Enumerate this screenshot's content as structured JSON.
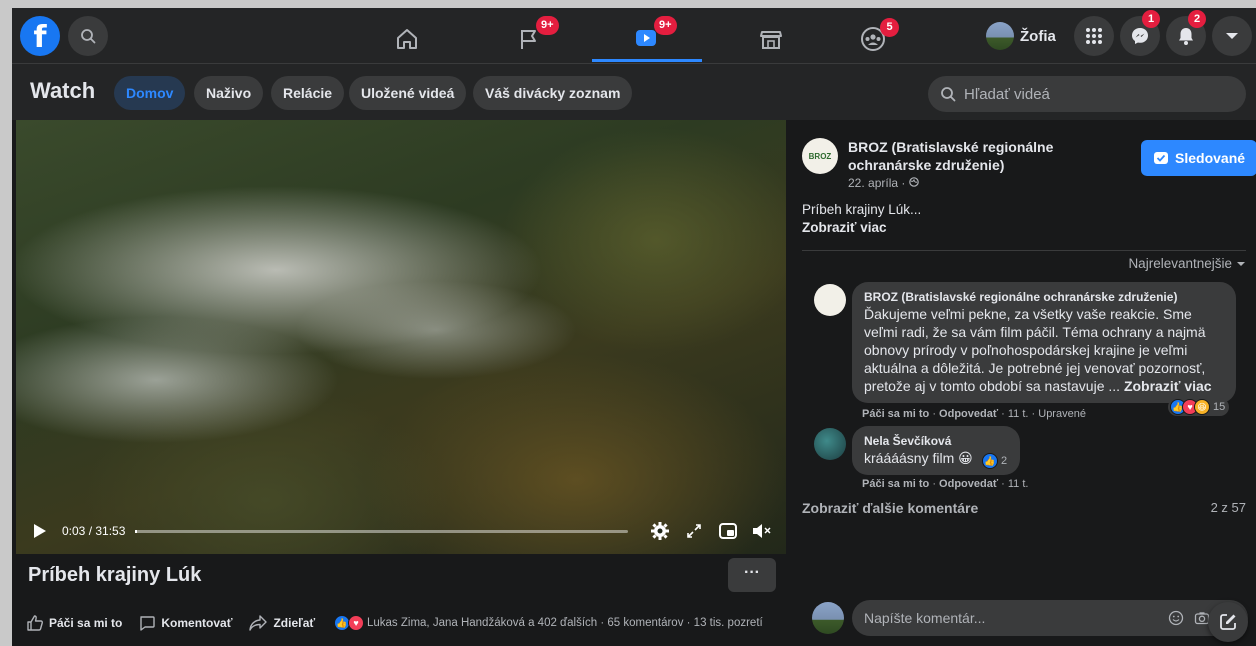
{
  "topbar": {
    "nav": [
      {
        "name": "home",
        "badge": ""
      },
      {
        "name": "pages",
        "badge": "9+"
      },
      {
        "name": "watch",
        "badge": "9+"
      },
      {
        "name": "marketplace",
        "badge": ""
      },
      {
        "name": "groups",
        "badge": "5"
      }
    ],
    "profile_name": "Žofia",
    "messenger_badge": "1",
    "notifications_badge": "2"
  },
  "watch": {
    "title": "Watch",
    "tabs": [
      "Domov",
      "Naživo",
      "Relácie",
      "Uložené videá",
      "Váš divácky zoznam"
    ],
    "active_tab": "Domov",
    "search_placeholder": "Hľadať videá"
  },
  "video": {
    "time": "0:03 / 31:53",
    "progress": 0.002,
    "title": "Príbeh krajiny Lúk",
    "more_label": "···",
    "actions": {
      "like": "Páči sa mi to",
      "comment": "Komentovať",
      "share": "Zdieľať"
    },
    "reactions_summary": "Lukas Zima, Jana Handžáková a 402 ďalších · 65 komentárov · 13 tis. pozretí"
  },
  "post": {
    "page_name": "BROZ (Bratislavské regionálne ochranárske združenie)",
    "avatar_text": "BROZ",
    "date": "22. apríla · ",
    "follow_label": "Sledované",
    "text": "Príbeh krajiny Lúk...",
    "see_more": "Zobraziť viac",
    "sort_label": "Najrelevantnejšie"
  },
  "comments": [
    {
      "author": "BROZ (Bratislavské regionálne ochranárske združenie)",
      "text": "Ďakujeme veľmi pekne, za všetky vaše reakcie. Sme veľmi radi, že sa vám film páčil. Téma ochrany a najmä obnovy prírody v poľnohospodárskej krajine je veľmi aktuálna a dôležitá. Je potrebné jej venovať pozornosť, pretože aj v tomto období sa nastavuje ... ",
      "see_more": "Zobraziť viac",
      "like": "Páči sa mi to",
      "reply": "Odpovedať",
      "time": " · 11 t. · Upravené",
      "reactions": "15"
    },
    {
      "author": "Nela Ševčíková",
      "text": "kráááásny film 😀",
      "like": "Páči sa mi to",
      "reply": "Odpovedať",
      "time": " · 11 t.",
      "reactions": "2"
    }
  ],
  "more_comments": "Zobraziť ďalšie komentáre",
  "comment_count": "2 z 57",
  "composer_placeholder": "Napíšte komentár...",
  "colors": {
    "accent": "#2d88ff",
    "badge": "#e41e3f",
    "bg": "#18191a",
    "surface": "#242526"
  }
}
